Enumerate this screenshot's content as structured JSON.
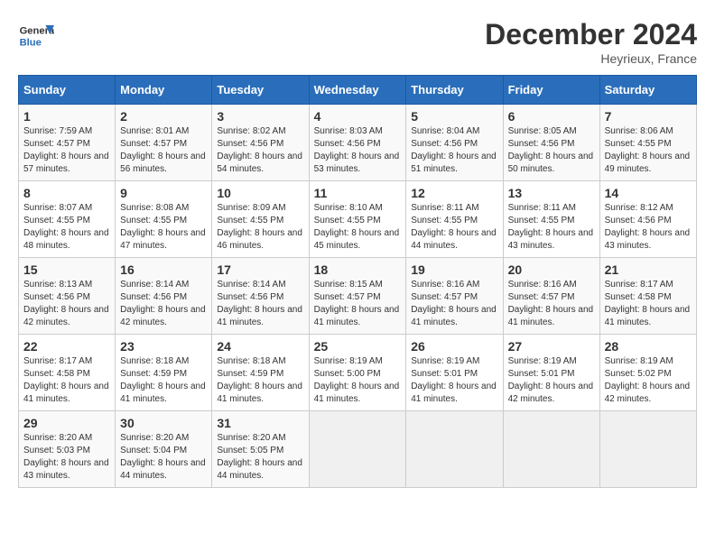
{
  "header": {
    "logo_general": "General",
    "logo_blue": "Blue",
    "month_title": "December 2024",
    "location": "Heyrieux, France"
  },
  "calendar": {
    "days_of_week": [
      "Sunday",
      "Monday",
      "Tuesday",
      "Wednesday",
      "Thursday",
      "Friday",
      "Saturday"
    ],
    "weeks": [
      [
        {
          "day": "",
          "info": ""
        },
        {
          "day": "2",
          "info": "Sunrise: 8:01 AM\nSunset: 4:57 PM\nDaylight: 8 hours and 56 minutes."
        },
        {
          "day": "3",
          "info": "Sunrise: 8:02 AM\nSunset: 4:56 PM\nDaylight: 8 hours and 54 minutes."
        },
        {
          "day": "4",
          "info": "Sunrise: 8:03 AM\nSunset: 4:56 PM\nDaylight: 8 hours and 53 minutes."
        },
        {
          "day": "5",
          "info": "Sunrise: 8:04 AM\nSunset: 4:56 PM\nDaylight: 8 hours and 51 minutes."
        },
        {
          "day": "6",
          "info": "Sunrise: 8:05 AM\nSunset: 4:56 PM\nDaylight: 8 hours and 50 minutes."
        },
        {
          "day": "7",
          "info": "Sunrise: 8:06 AM\nSunset: 4:55 PM\nDaylight: 8 hours and 49 minutes."
        }
      ],
      [
        {
          "day": "8",
          "info": "Sunrise: 8:07 AM\nSunset: 4:55 PM\nDaylight: 8 hours and 48 minutes."
        },
        {
          "day": "9",
          "info": "Sunrise: 8:08 AM\nSunset: 4:55 PM\nDaylight: 8 hours and 47 minutes."
        },
        {
          "day": "10",
          "info": "Sunrise: 8:09 AM\nSunset: 4:55 PM\nDaylight: 8 hours and 46 minutes."
        },
        {
          "day": "11",
          "info": "Sunrise: 8:10 AM\nSunset: 4:55 PM\nDaylight: 8 hours and 45 minutes."
        },
        {
          "day": "12",
          "info": "Sunrise: 8:11 AM\nSunset: 4:55 PM\nDaylight: 8 hours and 44 minutes."
        },
        {
          "day": "13",
          "info": "Sunrise: 8:11 AM\nSunset: 4:55 PM\nDaylight: 8 hours and 43 minutes."
        },
        {
          "day": "14",
          "info": "Sunrise: 8:12 AM\nSunset: 4:56 PM\nDaylight: 8 hours and 43 minutes."
        }
      ],
      [
        {
          "day": "15",
          "info": "Sunrise: 8:13 AM\nSunset: 4:56 PM\nDaylight: 8 hours and 42 minutes."
        },
        {
          "day": "16",
          "info": "Sunrise: 8:14 AM\nSunset: 4:56 PM\nDaylight: 8 hours and 42 minutes."
        },
        {
          "day": "17",
          "info": "Sunrise: 8:14 AM\nSunset: 4:56 PM\nDaylight: 8 hours and 41 minutes."
        },
        {
          "day": "18",
          "info": "Sunrise: 8:15 AM\nSunset: 4:57 PM\nDaylight: 8 hours and 41 minutes."
        },
        {
          "day": "19",
          "info": "Sunrise: 8:16 AM\nSunset: 4:57 PM\nDaylight: 8 hours and 41 minutes."
        },
        {
          "day": "20",
          "info": "Sunrise: 8:16 AM\nSunset: 4:57 PM\nDaylight: 8 hours and 41 minutes."
        },
        {
          "day": "21",
          "info": "Sunrise: 8:17 AM\nSunset: 4:58 PM\nDaylight: 8 hours and 41 minutes."
        }
      ],
      [
        {
          "day": "22",
          "info": "Sunrise: 8:17 AM\nSunset: 4:58 PM\nDaylight: 8 hours and 41 minutes."
        },
        {
          "day": "23",
          "info": "Sunrise: 8:18 AM\nSunset: 4:59 PM\nDaylight: 8 hours and 41 minutes."
        },
        {
          "day": "24",
          "info": "Sunrise: 8:18 AM\nSunset: 4:59 PM\nDaylight: 8 hours and 41 minutes."
        },
        {
          "day": "25",
          "info": "Sunrise: 8:19 AM\nSunset: 5:00 PM\nDaylight: 8 hours and 41 minutes."
        },
        {
          "day": "26",
          "info": "Sunrise: 8:19 AM\nSunset: 5:01 PM\nDaylight: 8 hours and 41 minutes."
        },
        {
          "day": "27",
          "info": "Sunrise: 8:19 AM\nSunset: 5:01 PM\nDaylight: 8 hours and 42 minutes."
        },
        {
          "day": "28",
          "info": "Sunrise: 8:19 AM\nSunset: 5:02 PM\nDaylight: 8 hours and 42 minutes."
        }
      ],
      [
        {
          "day": "29",
          "info": "Sunrise: 8:20 AM\nSunset: 5:03 PM\nDaylight: 8 hours and 43 minutes."
        },
        {
          "day": "30",
          "info": "Sunrise: 8:20 AM\nSunset: 5:04 PM\nDaylight: 8 hours and 44 minutes."
        },
        {
          "day": "31",
          "info": "Sunrise: 8:20 AM\nSunset: 5:05 PM\nDaylight: 8 hours and 44 minutes."
        },
        {
          "day": "",
          "info": ""
        },
        {
          "day": "",
          "info": ""
        },
        {
          "day": "",
          "info": ""
        },
        {
          "day": "",
          "info": ""
        }
      ]
    ],
    "week0_day1": {
      "day": "1",
      "info": "Sunrise: 7:59 AM\nSunset: 4:57 PM\nDaylight: 8 hours and 57 minutes."
    }
  }
}
